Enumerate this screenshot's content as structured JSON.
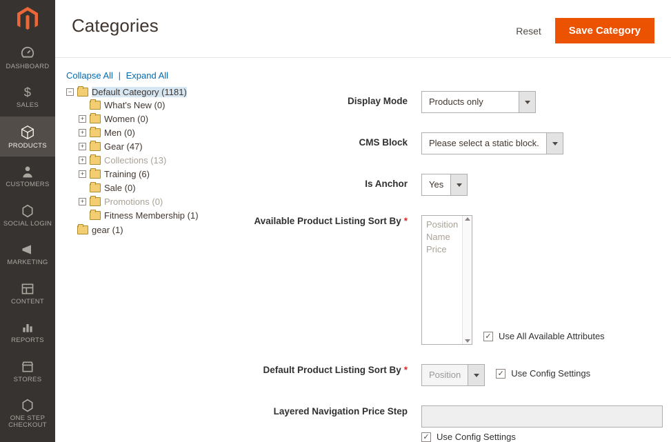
{
  "header": {
    "page_title": "Categories",
    "reset_label": "Reset",
    "save_label": "Save Category"
  },
  "sidebar_nav": {
    "items": [
      {
        "id": "dashboard",
        "label": "DASHBOARD"
      },
      {
        "id": "sales",
        "label": "SALES"
      },
      {
        "id": "products",
        "label": "PRODUCTS",
        "active": true
      },
      {
        "id": "customers",
        "label": "CUSTOMERS"
      },
      {
        "id": "social-login",
        "label": "SOCIAL LOGIN"
      },
      {
        "id": "marketing",
        "label": "MARKETING"
      },
      {
        "id": "content",
        "label": "CONTENT"
      },
      {
        "id": "reports",
        "label": "REPORTS"
      },
      {
        "id": "stores",
        "label": "STORES"
      },
      {
        "id": "one-step-checkout",
        "label": "ONE STEP\nCHECKOUT"
      }
    ]
  },
  "tree": {
    "collapse_label": "Collapse All",
    "expand_label": "Expand All",
    "root": {
      "label": "Default Category (1181)",
      "children": [
        {
          "label": "What's New (0)"
        },
        {
          "label": "Women (0)",
          "expandable": true
        },
        {
          "label": "Men (0)",
          "expandable": true
        },
        {
          "label": "Gear (47)",
          "expandable": true
        },
        {
          "label": "Collections (13)",
          "expandable": true,
          "disabled": true
        },
        {
          "label": "Training (6)",
          "expandable": true
        },
        {
          "label": "Sale (0)"
        },
        {
          "label": "Promotions (0)",
          "expandable": true,
          "disabled": true
        },
        {
          "label": "Fitness Membership (1)"
        }
      ]
    },
    "root2": {
      "label": "gear (1)"
    }
  },
  "form": {
    "display_mode": {
      "label": "Display Mode",
      "value": "Products only"
    },
    "cms_block": {
      "label": "CMS Block",
      "value": "Please select a static block."
    },
    "is_anchor": {
      "label": "Is Anchor",
      "value": "Yes"
    },
    "avail_sort": {
      "label": "Available Product Listing Sort By",
      "options": [
        "Position",
        "Name",
        "Price"
      ],
      "use_all_label": "Use All Available Attributes",
      "use_all_checked": true
    },
    "default_sort": {
      "label": "Default Product Listing Sort By",
      "value": "Position",
      "use_config_label": "Use Config Settings",
      "use_config_checked": true
    },
    "price_step": {
      "label": "Layered Navigation Price Step",
      "value": "",
      "use_config_label": "Use Config Settings",
      "use_config_checked": true
    }
  }
}
